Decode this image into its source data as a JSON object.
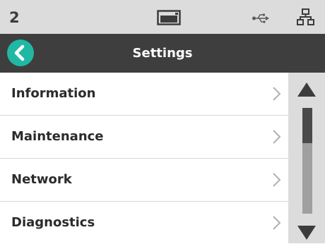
{
  "status_bar": {
    "number": "2",
    "icons": [
      "display-icon",
      "usb-icon",
      "network-icon"
    ]
  },
  "header": {
    "title": "Settings",
    "back_icon": "chevron-left-icon"
  },
  "menu": {
    "items": [
      {
        "label": "Information"
      },
      {
        "label": "Maintenance"
      },
      {
        "label": "Network"
      },
      {
        "label": "Diagnostics"
      }
    ]
  },
  "scrollbar": {
    "up_icon": "triangle-up-icon",
    "down_icon": "triangle-down-icon",
    "position_fraction": 0.0,
    "visible_fraction": 0.33
  },
  "colors": {
    "accent": "#20b8a4",
    "header_bg": "#3e3e3e",
    "status_bg": "#dcdcdc"
  }
}
